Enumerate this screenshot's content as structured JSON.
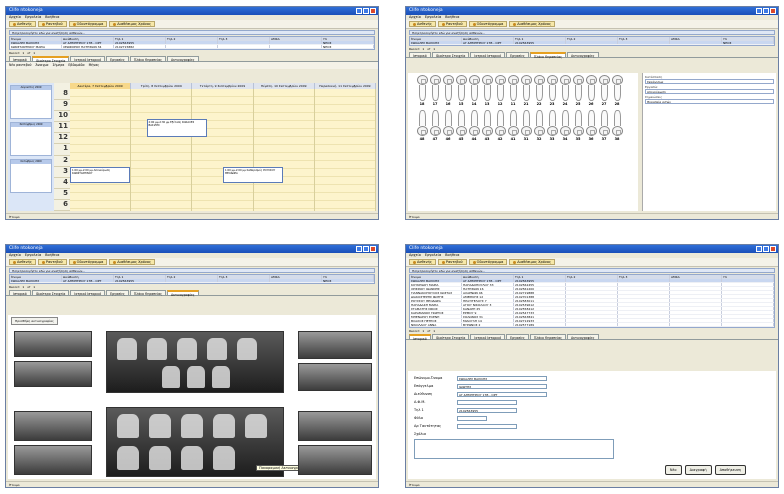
{
  "app": {
    "title": "Clife ntokoneja",
    "menu": [
      "Αρχείο",
      "Εργαλεία",
      "Βοήθεια"
    ],
    "nav_buttons": [
      "Ασθενής",
      "Ραντεβού",
      "Οδοντόγραμμα",
      "Διαθέσιμος Χρόνος"
    ],
    "search_placeholder": "Πληκτρολογήστε εδώ για αναζήτηση ασθενών...",
    "grid_headers": [
      "Όνομα",
      "Διεύθυνση",
      "Τηλ 1",
      "Τηλ 2",
      "Τηλ 3",
      "ΑΜΚΑ",
      "Υπ"
    ],
    "pager": [
      "Record",
      "1",
      "of",
      "1",
      "Page"
    ],
    "tabs": [
      "Ιστορικό",
      "Ιδιαίτερα Στοιχεία",
      "Ιατρικό Ιστορικό",
      "Εργασίες",
      "Πλάνο Θεραπείας",
      "Ακτινογραφίες"
    ],
    "status": "Έτοιμο"
  },
  "patients": [
    [
      "ΣΩΚΑΛΕΣ ΒΑΣΙΛΗΣ",
      "ΑΓ ΔΗΜΗΤΡΙΟΥ 17Β - ΟΡΤ",
      "2102563955",
      "",
      "",
      "",
      "ΝΕΟΣ"
    ],
    [
      "ΚΩΝΣΤΑΝΤΙΝΟΥ ΜΑΡΙΑ",
      "ΛΕΩΦΟΡΟΣ ΠΑΤΗΣΙΩΝ 34",
      "2102715882",
      "",
      "",
      "",
      "ΝΕΟΣ"
    ]
  ],
  "patients_full": [
    [
      "ΣΩΚΑΛΕΣ ΒΑΣΙΛΗΣ",
      "ΑΓ ΔΗΜΗΤΡΙΟΥ 17Β - ΟΡΤ",
      "2102563955"
    ],
    [
      "ΚΟΥΚΡΙΔΟΥ ΜΑΡΙΑ",
      "ΠΑΠΑΔΟΠΟΥΛΟΥ 33",
      "2102562455"
    ],
    [
      "ΧΡΙΣΙΝΟΥ ΙΩΑΝΝΗΣ",
      "ΠΑΤΗΣΙΩΝ 16",
      "2102561200"
    ],
    [
      "ΓΙΑΝΝΑΚΟΠΟΥΛΟΣ ΚΩΣΤΑΣ",
      "ΑΧΑΡΝΩΝ 46",
      "2102719888"
    ],
    [
      "ΔΙΑΚΟΣΤΕΡΗΣ ΦΩΤΗΣ",
      "ΑΜΕΡΙΚΗΣ 12",
      "2102701388"
    ],
    [
      "ΡΟΥΣΣΟΥ ΘΕΟΔΩΡΑ",
      "ΠΡΑΞΙΤΕΛΟΥΣ 7",
      "2102583011"
    ],
    [
      "ΠΑΠΑΔΑΚΗ ΜΑΡΙΑ",
      "ΑΓΙΟΥ ΝΙΚΟΛΑΟΥ 3",
      "2102539612"
    ],
    [
      "ΣΤΑΜΑΤΗΣ ΝΙΚΟΣ",
      "ΚΑΝΑΡΗ 25",
      "2102558412"
    ],
    [
      "ΚΑΡΑΜΑΝΟΣ ΓΙΩΡΓΟΣ",
      "ΕΡΜΟΥ 9",
      "2102547733"
    ],
    [
      "ΜΠΕΝΑΡΟΥ ΕΛΕΝΗ",
      "ΣΟΛΩΝΟΣ 31",
      "2102563841"
    ],
    [
      "ΒΛΑΧΟΣ ΠΕΤΡΟΣ",
      "ΜΙΑΟΥΛΗ 14",
      "2102712933"
    ],
    [
      "ΝΙΚΟΛΑΟΥ ΑΝΝΑ",
      "ΒΥΡΩΝΟΣ 2",
      "2102577189"
    ]
  ],
  "calendar": {
    "toolbar": [
      "Νέο ραντεβού",
      "Άνοιγμα",
      "Σήμερα",
      "Εβδομάδα",
      "Μήνας"
    ],
    "days": [
      "Δευτέρα, 7 Σεπτεμβρίου 2009",
      "Τρίτη, 8 Σεπτεμβρίου 2009",
      "Τετάρτη, 9 Σεπτεμβρίου 2009",
      "Πέμπτη, 10 Σεπτεμβρίου 2009",
      "Παρασκευή, 11 Σεπτεμβρίου 2009"
    ],
    "hours": [
      "8",
      "9",
      "10",
      "11",
      "12",
      "1",
      "2",
      "3",
      "4",
      "5",
      "6"
    ],
    "months": [
      "Αύγουστος 2009",
      "Σεπτέμβριος 2009",
      "Οκτώβριος 2009"
    ],
    "appointments": [
      {
        "text": "2:00 μμ-2:30 μμ Εξέταση ΣΩΚΑΛΕΣ ΒΑΣΙΛΗΣ"
      },
      {
        "text": "1:00 μμ-2:00 μμ Απονεύρωση ΚΩΝΣΤΑΝΤΙΝΟΥ"
      },
      {
        "text": "1:00 μμ-2:00 μμ Καθαρισμός ΡΟΥΣΣΟΥ ΘΕΟΔΩΡΑ"
      }
    ]
  },
  "dental": {
    "upper_numbers": [
      "18",
      "17",
      "16",
      "15",
      "14",
      "13",
      "12",
      "11",
      "21",
      "22",
      "23",
      "24",
      "25",
      "26",
      "27",
      "28"
    ],
    "lower_numbers": [
      "48",
      "47",
      "46",
      "45",
      "44",
      "43",
      "42",
      "41",
      "31",
      "32",
      "33",
      "34",
      "35",
      "36",
      "37",
      "38"
    ],
    "side_labels": [
      "Κατάσταση",
      "Εργασία",
      "Σημειώσεις"
    ],
    "side_values": [
      "Σφράγισμα",
      "Απονεύρωση",
      "Θεραπεία ριζών"
    ]
  },
  "xrays": {
    "button": "Προσθήκη ακτινογραφίας",
    "tooltip": "Πανοραμική Ακτινογραφία"
  },
  "form": {
    "fields": [
      {
        "label": "Επώνυμο-Όνομα",
        "value": "ΣΩΚΑΛΕΣ ΒΑΣΙΛΗΣ"
      },
      {
        "label": "Επάγγελμα",
        "value": "ΙΔΙΩΤΗΣ"
      },
      {
        "label": "Διεύθυνση",
        "value": "ΑΓ ΔΗΜΗΤΡΙΟΥ 17Β - ΟΡΤ"
      },
      {
        "label": "Α.Φ.Μ.",
        "value": ""
      },
      {
        "label": "Τηλ 1",
        "value": "2102563955"
      },
      {
        "label": "Φύλο",
        "value": ""
      },
      {
        "label": "Αρ Ταυτότητας",
        "value": ""
      }
    ],
    "notes_label": "Σχόλια",
    "buttons": [
      "Νέο",
      "Διαγραφή",
      "Αποθήκευση"
    ]
  }
}
